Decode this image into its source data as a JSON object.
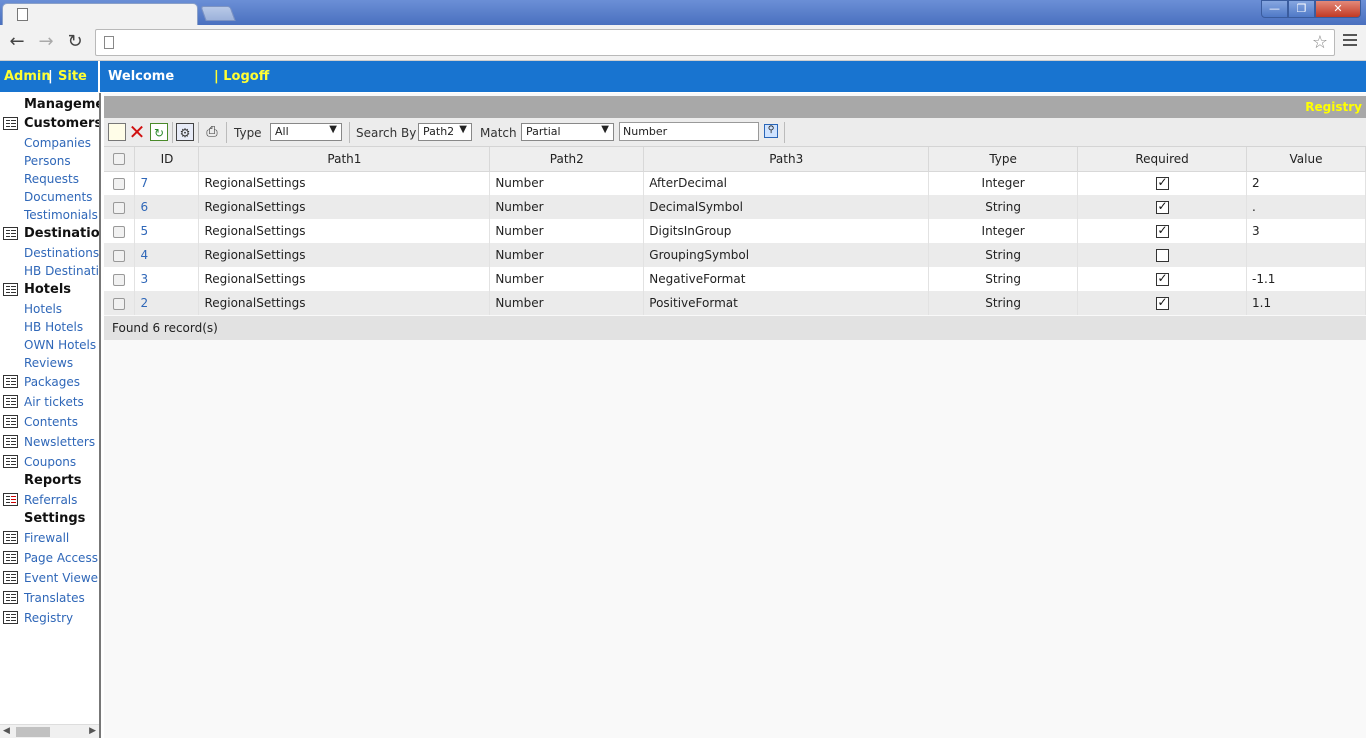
{
  "header": {
    "admin_label": "Admin",
    "separator": "|",
    "site_label": "Site",
    "welcome_label": "Welcome",
    "logoff_label": "| Logoff"
  },
  "sidebar": {
    "sections": [
      {
        "label": "Management",
        "icon": false
      },
      {
        "label": "Customers",
        "icon": true
      },
      {
        "label": "Companies",
        "sub": true
      },
      {
        "label": "Persons",
        "sub": true
      },
      {
        "label": "Requests",
        "sub": true
      },
      {
        "label": "Documents",
        "sub": true
      },
      {
        "label": "Testimonials",
        "sub": true
      },
      {
        "label": "Destinations",
        "icon": true
      },
      {
        "label": "Destinations",
        "sub": true
      },
      {
        "label": "HB Destinations",
        "sub": true
      },
      {
        "label": "Hotels",
        "icon": true
      },
      {
        "label": "Hotels",
        "sub": true
      },
      {
        "label": "HB Hotels",
        "sub": true
      },
      {
        "label": "OWN Hotels",
        "sub": true
      },
      {
        "label": "Reviews",
        "sub": true
      },
      {
        "label": "Packages",
        "sub": true,
        "icon": true
      },
      {
        "label": "Air tickets",
        "sub": true,
        "icon": true
      },
      {
        "label": "Contents",
        "sub": true,
        "icon": true
      },
      {
        "label": "Newsletters",
        "sub": true,
        "icon": true
      },
      {
        "label": "Coupons",
        "sub": true,
        "icon": true
      },
      {
        "label": "Reports",
        "icon": false
      },
      {
        "label": "Referrals",
        "sub": true,
        "icon": true
      },
      {
        "label": "Settings",
        "icon": false
      },
      {
        "label": "Firewall",
        "sub": true,
        "icon": true
      },
      {
        "label": "Page Access",
        "sub": true,
        "icon": true
      },
      {
        "label": "Event Viewer",
        "sub": true,
        "icon": true
      },
      {
        "label": "Translates",
        "sub": true,
        "icon": true
      },
      {
        "label": "Registry",
        "sub": true,
        "icon": true
      }
    ]
  },
  "main": {
    "title": "Registry",
    "filters": {
      "type_label": "Type",
      "type_value": "All",
      "search_by_label": "Search By",
      "search_by_value": "Path2",
      "match_label": "Match",
      "match_value": "Partial",
      "search_text": "Number"
    },
    "columns": [
      "ID",
      "Path1",
      "Path2",
      "Path3",
      "Type",
      "Required",
      "Value"
    ],
    "rows": [
      {
        "id": "7",
        "path1": "RegionalSettings",
        "path2": "Number",
        "path3": "AfterDecimal",
        "type": "Integer",
        "required": true,
        "value": "2"
      },
      {
        "id": "6",
        "path1": "RegionalSettings",
        "path2": "Number",
        "path3": "DecimalSymbol",
        "type": "String",
        "required": true,
        "value": "."
      },
      {
        "id": "5",
        "path1": "RegionalSettings",
        "path2": "Number",
        "path3": "DigitsInGroup",
        "type": "Integer",
        "required": true,
        "value": "3"
      },
      {
        "id": "4",
        "path1": "RegionalSettings",
        "path2": "Number",
        "path3": "GroupingSymbol",
        "type": "String",
        "required": false,
        "value": ""
      },
      {
        "id": "3",
        "path1": "RegionalSettings",
        "path2": "Number",
        "path3": "NegativeFormat",
        "type": "String",
        "required": true,
        "value": "-1.1"
      },
      {
        "id": "2",
        "path1": "RegionalSettings",
        "path2": "Number",
        "path3": "PositiveFormat",
        "type": "String",
        "required": true,
        "value": "1.1"
      }
    ],
    "footer": "Found 6 record(s)"
  },
  "colors": {
    "header_bg": "#1874d0",
    "link_yellow": "#ffff33",
    "title_yellow": "#ffff00",
    "link_blue": "#2f67b8"
  }
}
